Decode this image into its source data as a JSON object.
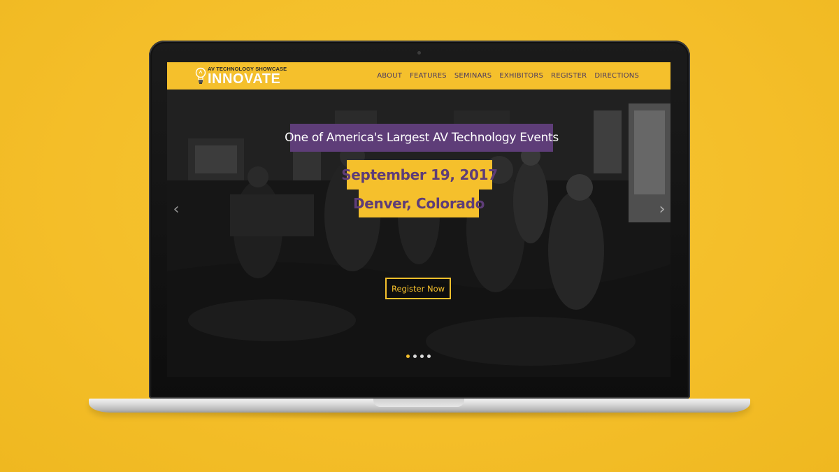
{
  "logo": {
    "tagline": "AV TECHNOLOGY SHOWCASE",
    "name": "INNOVATE",
    "icon": "lightbulb-icon"
  },
  "nav": {
    "items": [
      {
        "label": "ABOUT"
      },
      {
        "label": "FEATURES"
      },
      {
        "label": "SEMINARS"
      },
      {
        "label": "EXHIBITORS"
      },
      {
        "label": "REGISTER"
      },
      {
        "label": "DIRECTIONS"
      }
    ]
  },
  "hero": {
    "headline": "One of America's Largest AV Technology Events",
    "date": "September 19, 2017",
    "location": "Denver, Colorado",
    "cta_label": "Register Now",
    "prev_icon": "chevron-left-icon",
    "next_icon": "chevron-right-icon",
    "prev_glyph": "‹",
    "next_glyph": "›",
    "slide_count": 4,
    "active_slide": 1
  },
  "colors": {
    "brand_yellow": "#F5C02C",
    "brand_purple": "#5E3D78",
    "background": "#F5C02B"
  }
}
